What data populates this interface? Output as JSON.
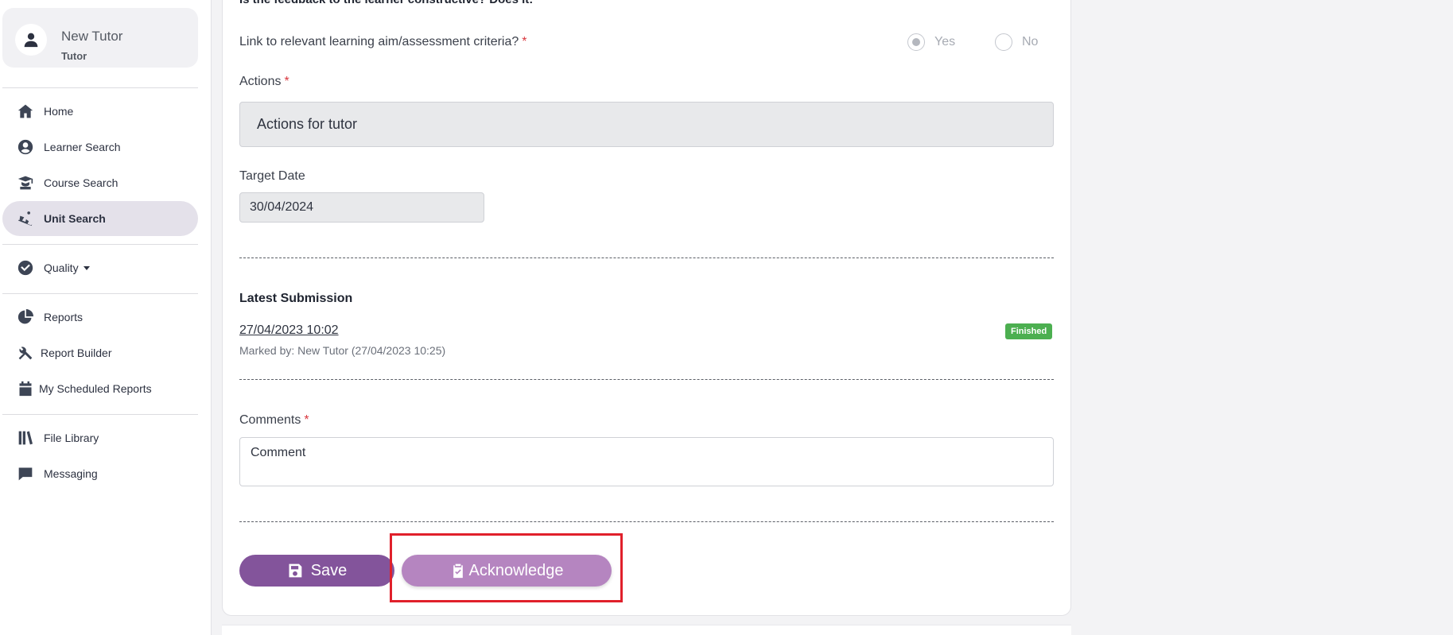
{
  "user": {
    "name": "New Tutor",
    "role": "Tutor"
  },
  "nav": {
    "home": "Home",
    "learner_search": "Learner Search",
    "course_search": "Course Search",
    "unit_search": "Unit Search",
    "quality": "Quality",
    "reports": "Reports",
    "report_builder": "Report Builder",
    "scheduled_reports": "My Scheduled Reports",
    "file_library": "File Library",
    "messaging": "Messaging"
  },
  "form": {
    "question_text": "Is the feedback to the learner constructive? Does it:",
    "link_label": "Link to relevant learning aim/assessment criteria?",
    "required_mark": "*",
    "radio_yes": "Yes",
    "radio_no": "No",
    "actions_label": "Actions",
    "actions_value": "Actions for tutor",
    "target_date_label": "Target Date",
    "target_date_value": "30/04/2024",
    "latest_submission_title": "Latest Submission",
    "submission_date": "27/04/2023 10:02",
    "marked_by": "Marked by: New Tutor (27/04/2023 10:25)",
    "status_badge": "Finished",
    "comments_label": "Comments",
    "comments_value": "Comment",
    "save_label": "Save",
    "acknowledge_label": "Acknowledge"
  },
  "colors": {
    "primary": "#83549b",
    "primary_light": "#b585c0",
    "badge_green": "#4caf50",
    "highlight_red": "#e0202b"
  }
}
